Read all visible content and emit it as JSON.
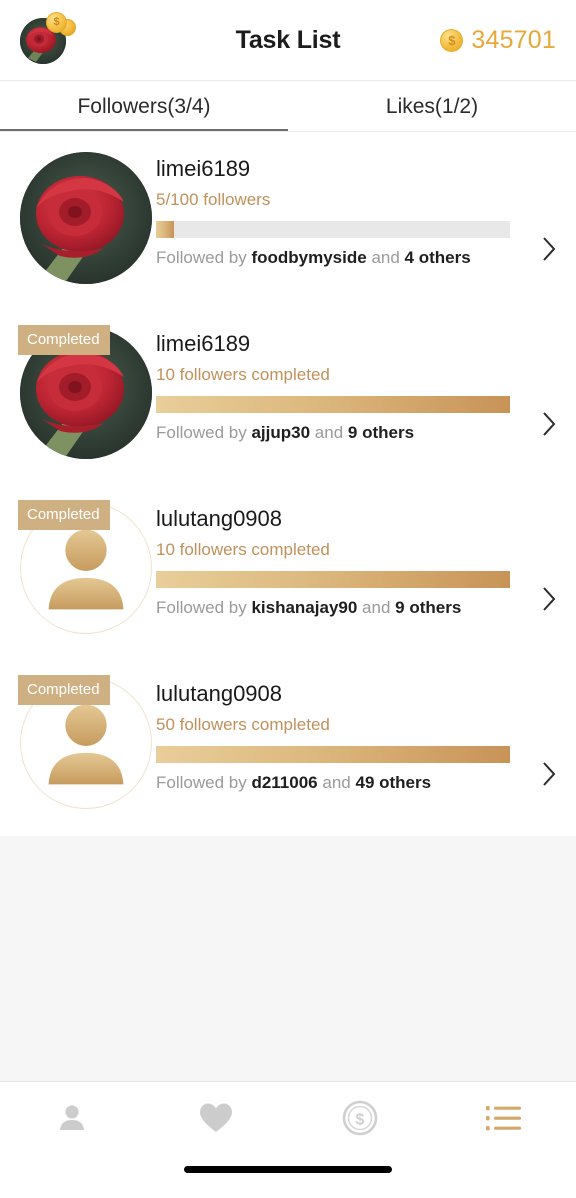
{
  "header": {
    "title": "Task List",
    "avatar_icon": "rose-photo-avatar",
    "avatar_coin_badge_icon": "gold-coins-badge",
    "coin_icon": "coin-dollar-icon",
    "coin_symbol": "$",
    "coin_count": "345701",
    "coin_color": "#e8a83a"
  },
  "tabs": [
    {
      "label": "Followers(3/4)",
      "name": "tab-followers",
      "active": true
    },
    {
      "label": "Likes(1/2)",
      "name": "tab-likes",
      "active": false
    }
  ],
  "tasks": [
    {
      "username": "limei6189",
      "status_text": "5/100 followers",
      "progress_percent": 5,
      "completed": false,
      "badge_label": "",
      "avatar_type": "rose-photo",
      "followed_prefix": "Followed by",
      "followed_user": "foodbymyside",
      "followed_conj": "and",
      "followed_others": "4 others",
      "chevron_icon": "chevron-right-icon"
    },
    {
      "username": "limei6189",
      "status_text": "10 followers completed",
      "progress_percent": 100,
      "completed": true,
      "badge_label": "Completed",
      "avatar_type": "rose-photo",
      "followed_prefix": "Followed by",
      "followed_user": "ajjup30",
      "followed_conj": "and",
      "followed_others": "9 others",
      "chevron_icon": "chevron-right-icon"
    },
    {
      "username": "lulutang0908",
      "status_text": "10 followers completed",
      "progress_percent": 100,
      "completed": true,
      "badge_label": "Completed",
      "avatar_type": "person-placeholder",
      "followed_prefix": "Followed by",
      "followed_user": "kishanajay90",
      "followed_conj": "and",
      "followed_others": "9 others",
      "chevron_icon": "chevron-right-icon"
    },
    {
      "username": "lulutang0908",
      "status_text": "50 followers completed",
      "progress_percent": 100,
      "completed": true,
      "badge_label": "Completed",
      "avatar_type": "person-placeholder",
      "followed_prefix": "Followed by",
      "followed_user": "d211006",
      "followed_conj": "and",
      "followed_others": "49 others",
      "chevron_icon": "chevron-right-icon"
    }
  ],
  "bottom_nav": [
    {
      "name": "nav-profile",
      "icon": "person-icon",
      "active": false
    },
    {
      "name": "nav-likes",
      "icon": "heart-icon",
      "active": false
    },
    {
      "name": "nav-coins",
      "icon": "coin-dollar-icon",
      "active": false
    },
    {
      "name": "nav-tasks",
      "icon": "list-icon",
      "active": true
    }
  ],
  "colors": {
    "accent_gold": "#c0915a",
    "badge_tan": "#cfb083",
    "coin_gold": "#e8a83a",
    "progress_track": "#e8e8e8",
    "inactive_nav": "#cccccc",
    "page_bg": "#f6f6f6"
  }
}
